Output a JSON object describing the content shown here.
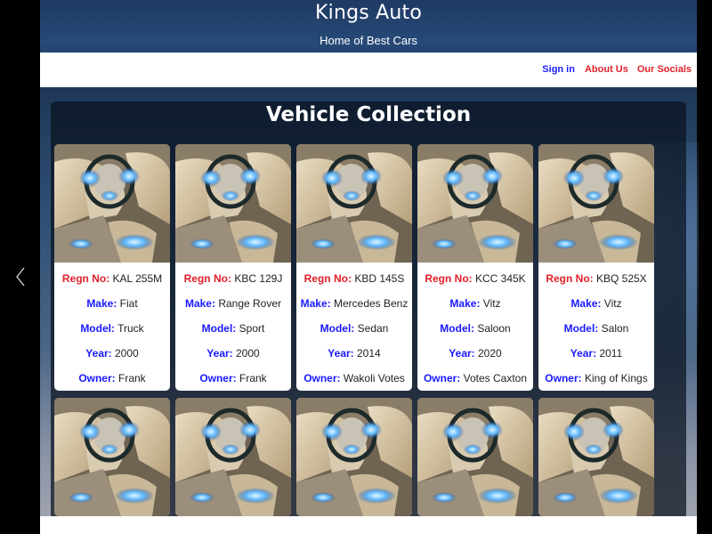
{
  "site": {
    "title": "Kings Auto",
    "subtitle": "Home of Best Cars"
  },
  "nav": {
    "signin": "Sign in",
    "about": "About Us",
    "socials": "Our Socials"
  },
  "collection": {
    "title": "Vehicle Collection",
    "labels": {
      "regn": "Regn No:",
      "make": "Make:",
      "model": "Model:",
      "year": "Year:",
      "owner": "Owner:"
    },
    "vehicles": [
      {
        "regn": "KAL 255M",
        "make": "Fiat",
        "model": "Truck",
        "year": "2000",
        "owner": "Frank"
      },
      {
        "regn": "KBC 129J",
        "make": "Range Rover",
        "model": "Sport",
        "year": "2000",
        "owner": "Frank"
      },
      {
        "regn": "KBD 145S",
        "make": "Mercedes Benz",
        "model": "Sedan",
        "year": "2014",
        "owner": "Wakoli Votes"
      },
      {
        "regn": "KCC 345K",
        "make": "Vitz",
        "model": "Saloon",
        "year": "2020",
        "owner": "Votes Caxton"
      },
      {
        "regn": "KBQ 525X",
        "make": "Vitz",
        "model": "Salon",
        "year": "2011",
        "owner": "King of Kings"
      }
    ]
  },
  "icons": {
    "prev": "chevron-left-icon",
    "card_image": "car-interior-image"
  },
  "colors": {
    "label_red": "#e0202a",
    "label_blue": "#1a1aff",
    "header_bg": "#1f3a63"
  }
}
